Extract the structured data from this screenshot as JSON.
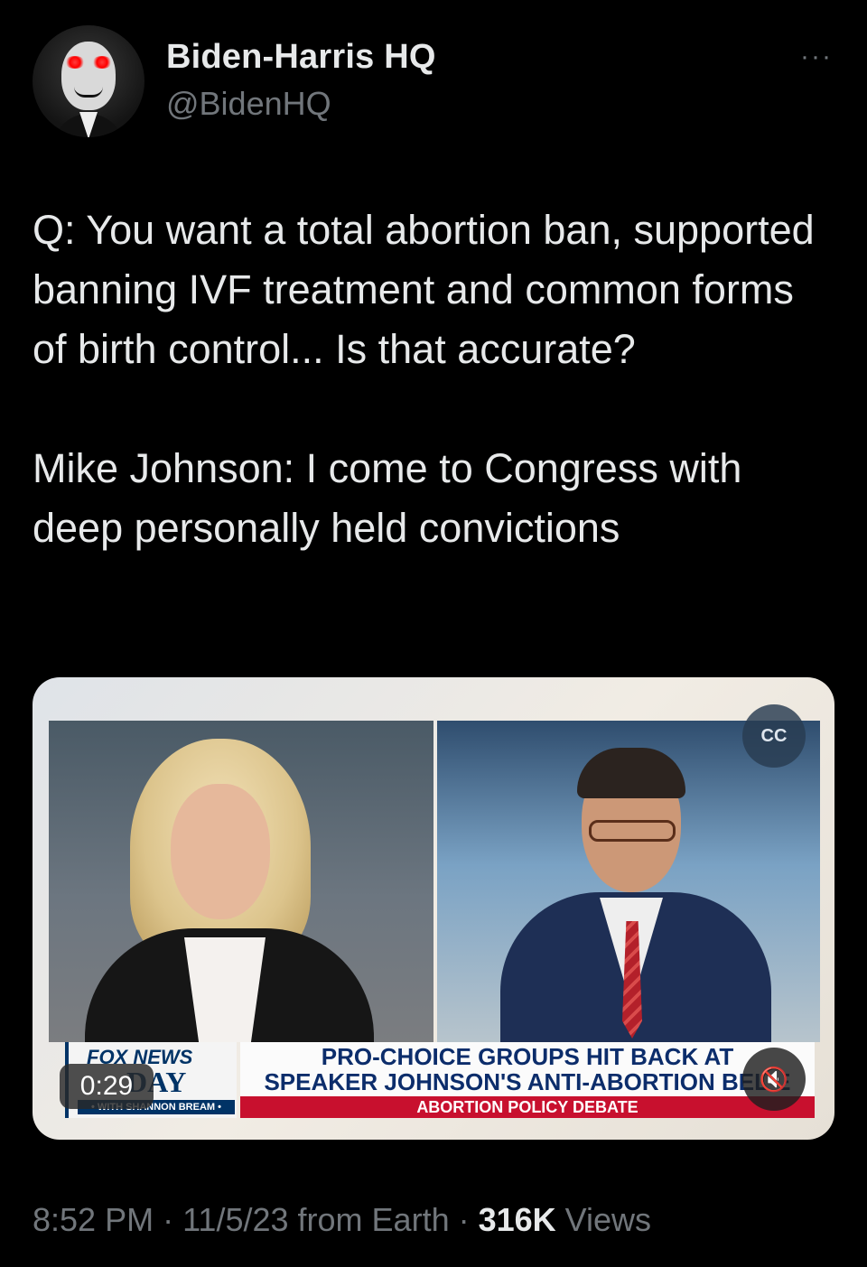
{
  "tweet": {
    "author_name": "Biden-Harris HQ",
    "author_handle": "@BidenHQ",
    "more_icon": "···",
    "text_paragraph_1": "Q: You want a total abortion ban, supported banning IVF treatment and common forms of birth control... Is that accurate?",
    "text_paragraph_2": "Mike Johnson: I come to Congress with deep personally held convictions"
  },
  "video": {
    "timer": "0:29",
    "cc_icon": "closed-captions-off-icon",
    "cc_label": "CC",
    "mute_icon": "speaker-muted-icon",
    "mute_glyph": "🔇",
    "network": "FOX NEWS",
    "show": "DAY",
    "host": "• WITH SHANNON BREAM •",
    "headline_line_1": "PRO-CHOICE GROUPS HIT BACK AT",
    "headline_line_2": "SPEAKER JOHNSON'S ANTI-ABORTION BELIE",
    "tag": "ABORTION POLICY DEBATE"
  },
  "meta": {
    "time": "8:52 PM",
    "separator": " · ",
    "date": "11/5/23",
    "source": "from Earth",
    "views_count": "316K",
    "views_label": "Views"
  },
  "colors": {
    "background": "#000000",
    "primary_text": "#e7e9ea",
    "secondary_text": "#71767b",
    "fox_blue": "#003366",
    "fox_red": "#c8102e"
  }
}
